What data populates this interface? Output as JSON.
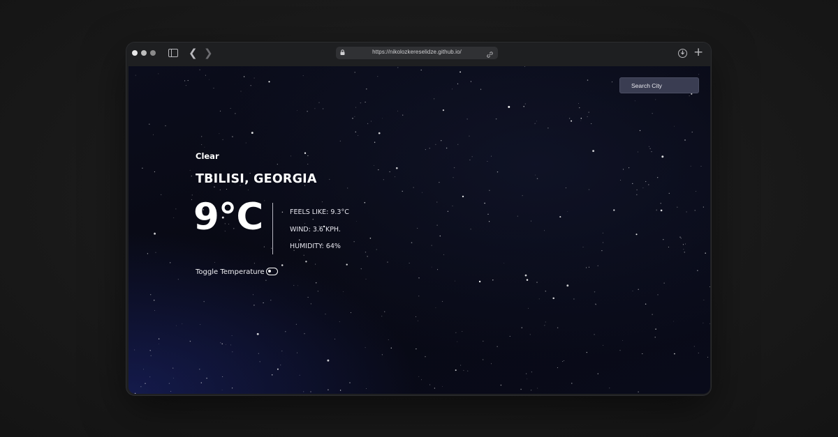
{
  "browser": {
    "url": "https://nikolozkereselidze.github.io/",
    "icons": [
      "sidebar-icon",
      "back-icon",
      "forward-icon",
      "lock-icon",
      "link-icon",
      "download-icon",
      "plus-icon"
    ]
  },
  "header": {
    "search_label": "Search City"
  },
  "weather": {
    "condition": "Clear",
    "location": "TBILISI, GEORGIA",
    "temperature": "9°C",
    "feels_like": "FEELS LIKE: 9.3°C",
    "wind": "WIND: 3.6 KPH.",
    "humidity": "HUMIDITY: 64%",
    "toggle_label": "Toggle Temperature",
    "toggle_on": false
  },
  "colors": {
    "page_bg": "#1a1a1a",
    "browser_chrome": "#1e1f21",
    "sky": "#080913",
    "search_button": "#3a3d52",
    "text": "#ffffff"
  }
}
